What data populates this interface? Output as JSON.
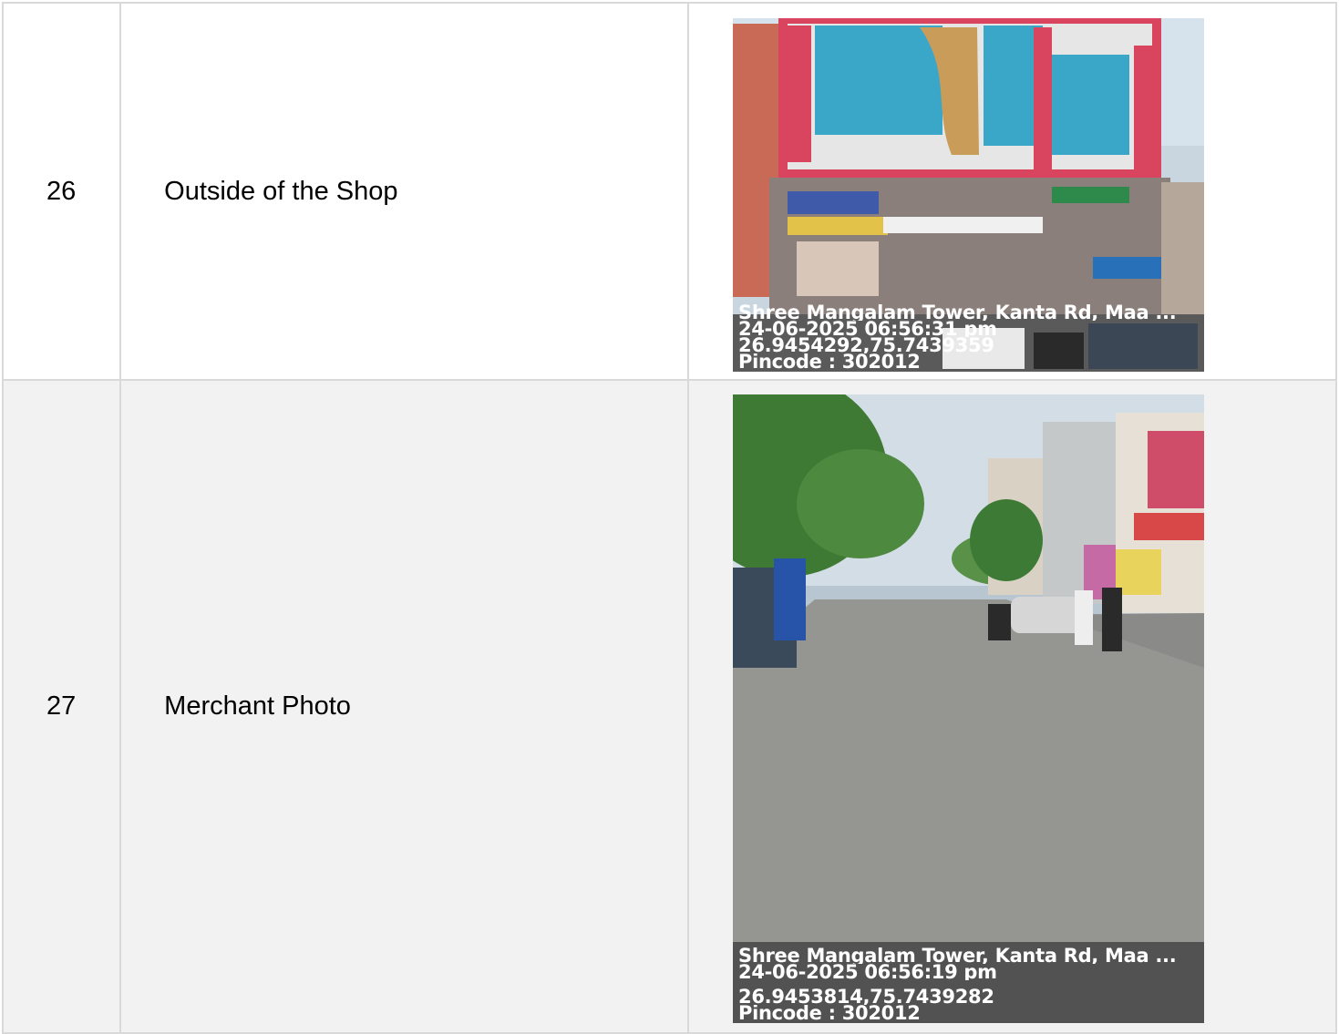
{
  "rows": [
    {
      "number": "26",
      "label": "Outside of the Shop",
      "photo": {
        "icon": "storefront-building-photo",
        "caption": {
          "location": "Shree Mangalam Tower, Kanta Rd, Maa ...",
          "datetime": "24-06-2025 06:56:31 pm",
          "coordinates": "26.9454292,75.7439359",
          "pincode": "Pincode : 302012"
        }
      }
    },
    {
      "number": "27",
      "label": "Merchant Photo",
      "photo": {
        "icon": "street-photo",
        "caption": {
          "location": "Shree Mangalam Tower, Kanta Rd, Maa ...",
          "datetime": "24-06-2025 06:56:19 pm",
          "coordinates": "26.9453814,75.7439282",
          "pincode": "Pincode : 302012"
        }
      }
    }
  ],
  "colors": {
    "border": "#d9d9d9",
    "row_alt_bg": "#f2f2f2"
  }
}
